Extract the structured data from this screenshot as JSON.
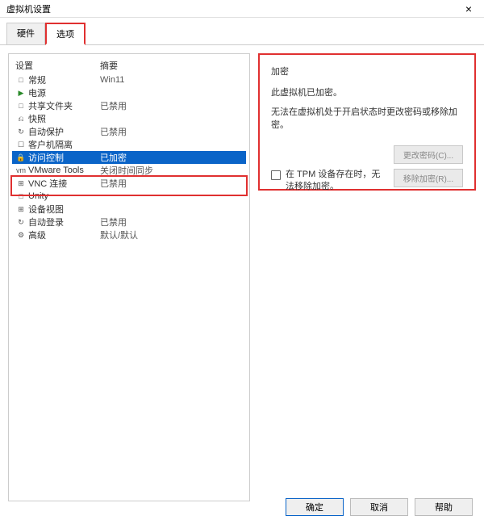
{
  "window": {
    "title": "虚拟机设置"
  },
  "tabs": {
    "hardware": "硬件",
    "options": "选项"
  },
  "list": {
    "header_setting": "设置",
    "header_summary": "摘要",
    "rows": [
      {
        "icon": "□",
        "label": "常规",
        "summary": "Win11"
      },
      {
        "icon": "▶",
        "label": "电源",
        "summary": ""
      },
      {
        "icon": "□",
        "label": "共享文件夹",
        "summary": "已禁用"
      },
      {
        "icon": "⎌",
        "label": "快照",
        "summary": ""
      },
      {
        "icon": "↻",
        "label": "自动保护",
        "summary": "已禁用"
      },
      {
        "icon": "☐",
        "label": "客户机隔离",
        "summary": ""
      },
      {
        "icon": "🔒",
        "label": "访问控制",
        "summary": "已加密"
      },
      {
        "icon": "vm",
        "label": "VMware Tools",
        "summary": "关闭时间同步"
      },
      {
        "icon": "⊞",
        "label": "VNC 连接",
        "summary": "已禁用"
      },
      {
        "icon": "□",
        "label": "Unity",
        "summary": ""
      },
      {
        "icon": "⊞",
        "label": "设备视图",
        "summary": ""
      },
      {
        "icon": "↻",
        "label": "自动登录",
        "summary": "已禁用"
      },
      {
        "icon": "⚙",
        "label": "高级",
        "summary": "默认/默认"
      }
    ],
    "selected_index": 6
  },
  "panel": {
    "title": "加密",
    "status": "此虚拟机已加密。",
    "warning": "无法在虚拟机处于开启状态时更改密码或移除加密。",
    "btn_change": "更改密码(C)...",
    "btn_remove": "移除加密(R)...",
    "tpm_text": "在 TPM 设备存在时，无法移除加密。"
  },
  "footer": {
    "ok": "确定",
    "cancel": "取消",
    "help": "帮助"
  }
}
